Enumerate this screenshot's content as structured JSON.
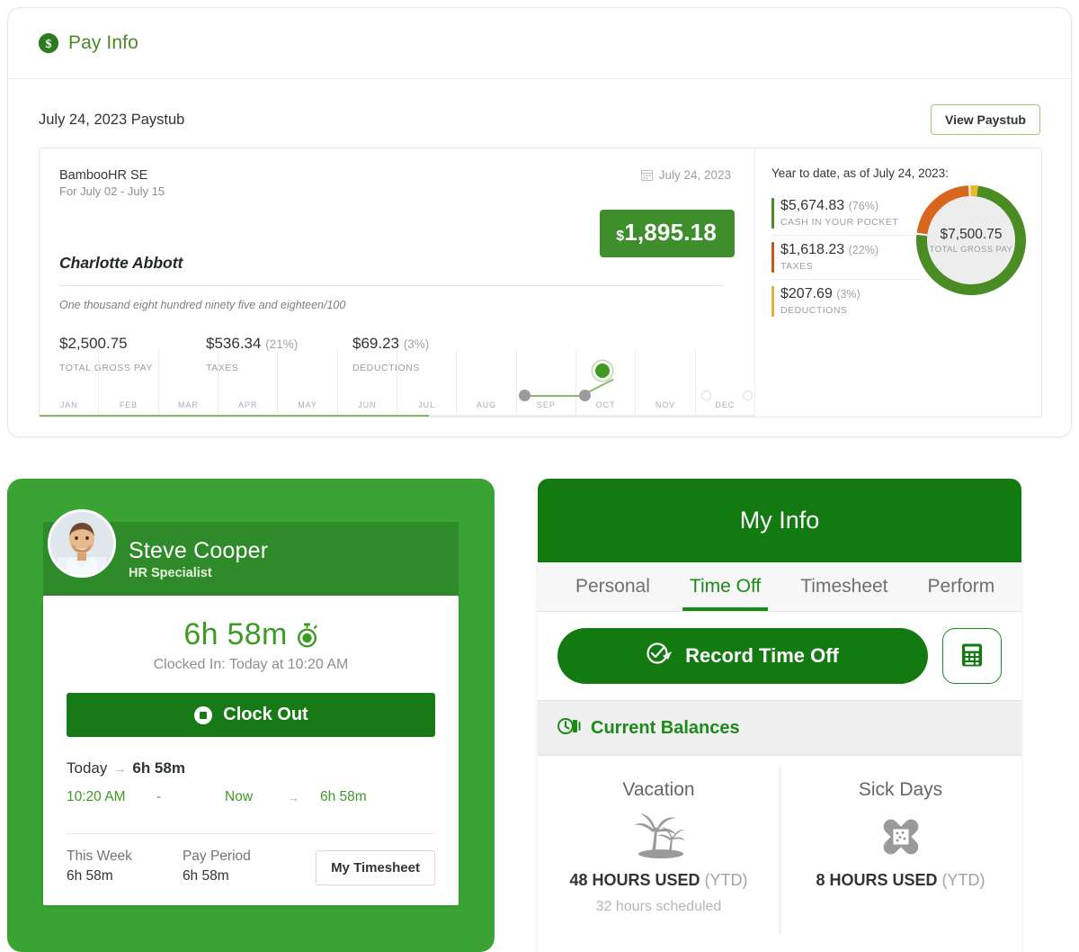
{
  "colors": {
    "brand_green": "#3e8e2c",
    "dark_green": "#137a12",
    "light_green": "#3aa333",
    "orange": "#d9661f",
    "yellow": "#e8b72b",
    "gray_text": "#9a9ea1"
  },
  "pay_info": {
    "title": "Pay Info",
    "icon": "dollar-circle-icon",
    "paystub_heading": "July 24, 2023 Paystub",
    "view_paystub_label": "View Paystub",
    "stub": {
      "company": "BambooHR SE",
      "period": "For July 02 - July 15",
      "date": "July 24, 2023",
      "date_icon": "calendar-icon",
      "net_currency": "$",
      "net_amount": "1,895.18",
      "employee": "Charlotte Abbott",
      "written_amount": "One thousand eight hundred ninety five and eighteen/100",
      "totals": [
        {
          "value": "$2,500.75",
          "pct": "",
          "label": "TOTAL GROSS PAY"
        },
        {
          "value": "$536.34",
          "pct": "(21%)",
          "label": "TAXES"
        },
        {
          "value": "$69.23",
          "pct": "(3%)",
          "label": "DEDUCTIONS"
        }
      ]
    },
    "ytd": {
      "title": "Year to date, as of July 24, 2023:",
      "items": [
        {
          "value": "$5,674.83",
          "pct": "(76%)",
          "label": "CASH IN YOUR POCKET",
          "color": "#4a8b23"
        },
        {
          "value": "$1,618.23",
          "pct": "(22%)",
          "label": "TAXES",
          "color": "#c8541c"
        },
        {
          "value": "$207.69",
          "pct": "(3%)",
          "label": "DEDUCTIONS",
          "color": "#e0b33c"
        }
      ],
      "donut_center_amount": "$7,500.75",
      "donut_center_label": "TOTAL GROSS PAY"
    },
    "timeline": {
      "months": [
        "JAN",
        "FEB",
        "MAR",
        "APR",
        "MAY",
        "JUN",
        "JUL",
        "AUG",
        "SEP",
        "OCT",
        "NOV",
        "DEC"
      ]
    }
  },
  "time_clock": {
    "avatar": "employee-photo",
    "name": "Steve Cooper",
    "role": "HR Specialist",
    "elapsed": "6h 58m",
    "elapsed_icon": "stopwatch-icon",
    "clocked_in": "Clocked In: Today at 10:20 AM",
    "clock_out_label": "Clock Out",
    "clock_out_icon": "stop-icon",
    "today_label": "Today",
    "today_arrow": "→",
    "today_duration": "6h 58m",
    "entry": {
      "start": "10:20 AM",
      "dash": "-",
      "end": "Now",
      "arrow": "→",
      "duration": "6h 58m"
    },
    "summary": [
      {
        "label": "This Week",
        "value": "6h 58m"
      },
      {
        "label": "Pay Period",
        "value": "6h 58m"
      }
    ],
    "timesheet_label": "My Timesheet"
  },
  "my_info": {
    "title": "My Info",
    "tabs": [
      {
        "label": "Personal",
        "active": false
      },
      {
        "label": "Time Off",
        "active": true
      },
      {
        "label": "Timesheet",
        "active": false
      },
      {
        "label": "Perform",
        "active": false
      }
    ],
    "record_time_off_label": "Record Time Off",
    "record_icon": "time-off-icon",
    "calculator_icon": "calculator-icon",
    "balances_title": "Current Balances",
    "balances_icon": "clock-balance-icon",
    "balances": [
      {
        "name": "Vacation",
        "icon": "palm-tree-icon",
        "used": "48 HOURS USED",
        "ytd": "(YTD)",
        "scheduled": "32 hours scheduled"
      },
      {
        "name": "Sick Days",
        "icon": "bandage-icon",
        "used": "8 HOURS USED",
        "ytd": "(YTD)",
        "scheduled": ""
      }
    ]
  },
  "chart_data": [
    {
      "type": "pie",
      "title": "Year to date gross pay breakdown",
      "categories": [
        "Cash in your pocket",
        "Taxes",
        "Deductions"
      ],
      "values": [
        5674.83,
        1618.23,
        207.69
      ],
      "percentages": [
        76,
        22,
        3
      ],
      "colors": [
        "#4a8b23",
        "#d9661f",
        "#e8b72b"
      ],
      "center_label": "$7,500.75 TOTAL GROSS PAY",
      "legend": "left"
    },
    {
      "type": "line",
      "title": "Paystub timeline by month",
      "categories": [
        "JAN",
        "FEB",
        "MAR",
        "APR",
        "MAY",
        "JUN",
        "JUL",
        "AUG",
        "SEP",
        "OCT",
        "NOV",
        "DEC"
      ],
      "points": [
        {
          "month": "JUN",
          "state": "past"
        },
        {
          "month": "JUL",
          "state": "past"
        },
        {
          "month": "JUL",
          "state": "current"
        },
        {
          "month": "AUG",
          "state": "future"
        },
        {
          "month": "AUG",
          "state": "future"
        },
        {
          "month": "SEP",
          "state": "future"
        },
        {
          "month": "SEP",
          "state": "future"
        },
        {
          "month": "OCT",
          "state": "future"
        },
        {
          "month": "OCT",
          "state": "future"
        },
        {
          "month": "NOV",
          "state": "future"
        },
        {
          "month": "NOV",
          "state": "future"
        },
        {
          "month": "DEC",
          "state": "future"
        }
      ],
      "grid": true,
      "legend": "none"
    }
  ]
}
